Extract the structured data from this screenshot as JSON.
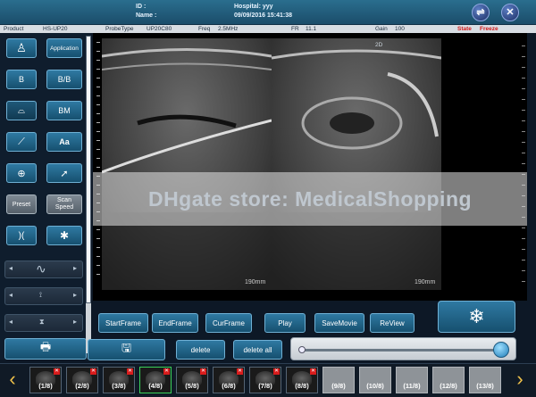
{
  "header": {
    "id_label": "ID :",
    "name_label": "Name :",
    "hospital": "Hospital: yyy",
    "datetime": "09/09/2016 15:41:38"
  },
  "status": {
    "product": "Product",
    "model": "HS-UP20",
    "probe_type": "ProbeType",
    "probe": "UP20C80",
    "freq_label": "Freq",
    "freq": "2.5MHz",
    "fr_label": "FR",
    "fr": "11.1",
    "gain_label": "Gain",
    "gain": "100",
    "state_label": "State",
    "state": "Freeze"
  },
  "left": {
    "application": "Application",
    "b": "B",
    "bb": "B/B",
    "bm": "BM",
    "preset": "Preset",
    "scan_speed": "Scan Speed",
    "aa": "Aa"
  },
  "image": {
    "mode_tag": "2D",
    "depth_left": "190mm",
    "depth_right": "190mm"
  },
  "watermark": "DHgate store: MedicalShopping",
  "controls": {
    "start_frame": "StartFrame",
    "end_frame": "EndFrame",
    "cur_frame": "CurFrame",
    "play": "Play",
    "save_movie": "SaveMovie",
    "review": "ReView",
    "delete": "delete",
    "delete_all": "delete all"
  },
  "thumbnails": [
    "(1/8)",
    "(2/8)",
    "(3/8)",
    "(4/8)",
    "(5/8)",
    "(6/8)",
    "(7/8)",
    "(8/8)",
    "(9/8)",
    "(10/8)",
    "(11/8)",
    "(12/8)",
    "(13/8)"
  ]
}
